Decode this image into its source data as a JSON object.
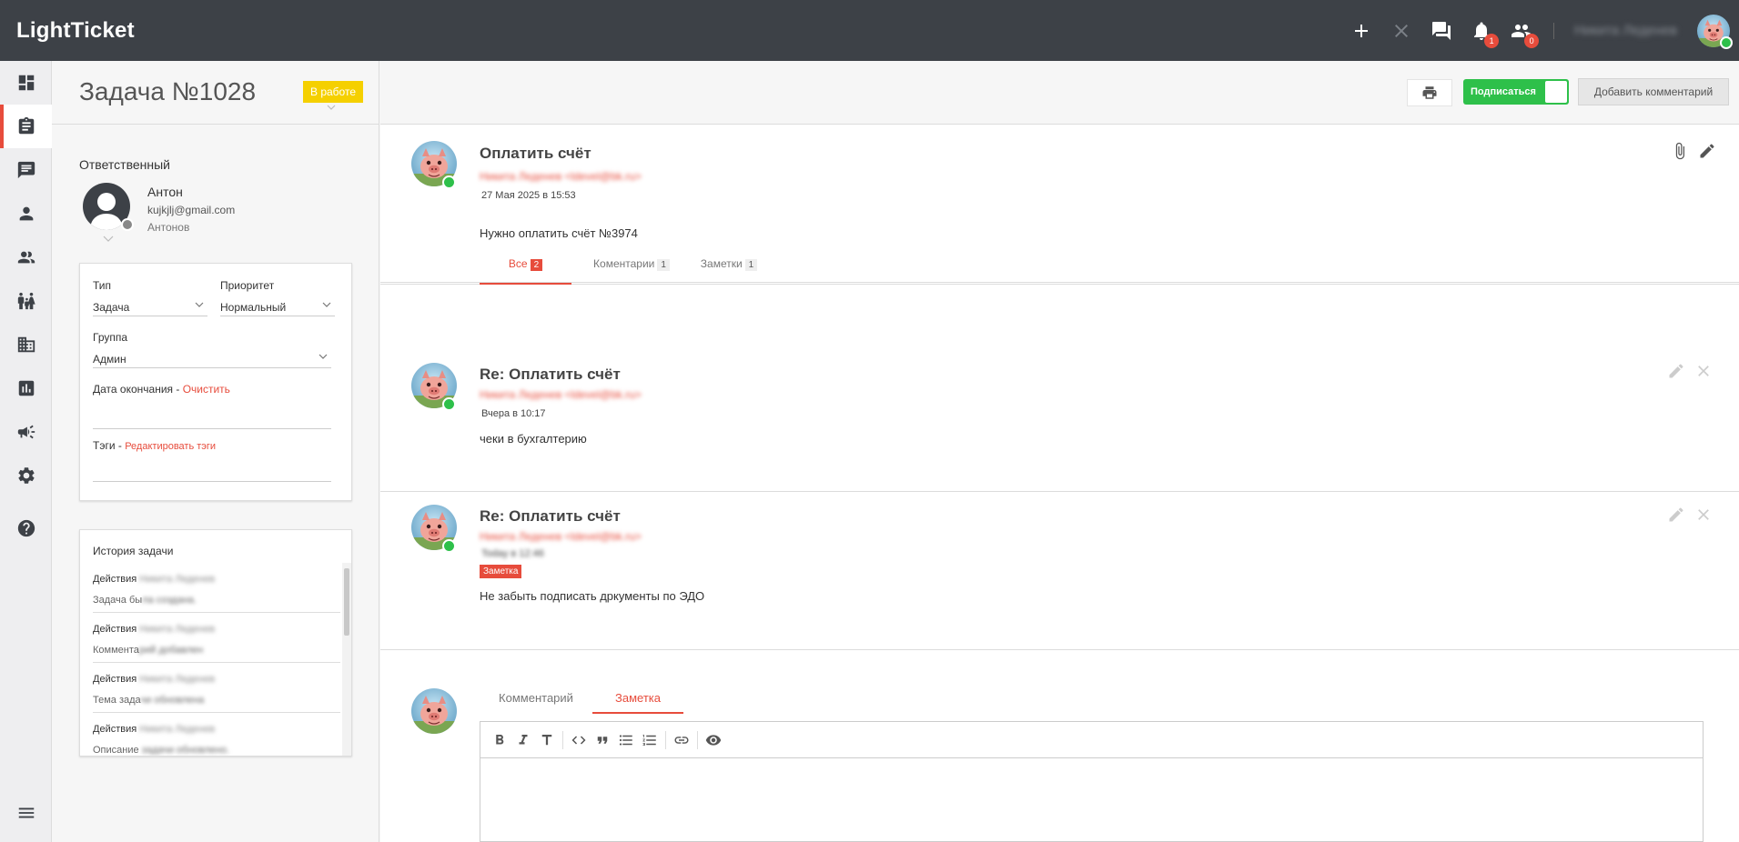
{
  "app": {
    "logo": "LightTicket"
  },
  "topbar": {
    "notifications_count": "1",
    "users_count": "0",
    "user_name": "Никита Леденев"
  },
  "task": {
    "title": "Задача №1028",
    "status": "В работе",
    "responsible_label": "Ответственный",
    "responsible_name": "Антон",
    "responsible_email": "kujkjlj@gmail.com",
    "responsible_sub": "Антонов"
  },
  "props": {
    "type_label": "Тип",
    "type_value": "Задача",
    "priority_label": "Приоритет",
    "priority_value": "Нормальный",
    "group_label": "Группа",
    "group_value": "Админ",
    "due_label": "Дата окончания - ",
    "due_clear": "Очистить",
    "tags_label": "Тэги - ",
    "tags_edit": "Редактировать тэги"
  },
  "history": {
    "title": "История задачи",
    "items": [
      {
        "action": "Действия",
        "user": "Никита Леденев",
        "desc_visible": "Задача бы",
        "desc_blur": "ла создана."
      },
      {
        "action": "Действия",
        "user": "Никита Леденев",
        "desc_visible": "Коммента",
        "desc_blur": "рий добавлен"
      },
      {
        "action": "Действия",
        "user": "Никита Леденев",
        "desc_visible": "Тема зада",
        "desc_blur": "чи обновлена"
      },
      {
        "action": "Действия",
        "user": "Никита Леденев",
        "desc_visible": "Описание ",
        "desc_blur": "задачи обновлено."
      }
    ]
  },
  "toolbar": {
    "subscribe_label": "Подписаться",
    "add_comment_label": "Добавить комментарий"
  },
  "main_post": {
    "title": "Оплатить счёт",
    "author": "Никита Леденев <ldevel@bk.ru>",
    "date": "27 Мая 2025 в 15:53",
    "body": "Нужно оплатить счёт №3974"
  },
  "tabs": [
    {
      "label": "Все",
      "count": "2"
    },
    {
      "label": "Коментарии",
      "count": "1"
    },
    {
      "label": "Заметки",
      "count": "1"
    }
  ],
  "comments": [
    {
      "title": "Re: Оплатить счёт",
      "author": "Никита Леденев <ldevel@bk.ru>",
      "date": "Вчера в 10:17",
      "body": "чеки в бухгалтерию"
    },
    {
      "title": "Re: Оплатить счёт",
      "author": "Никита Леденев <ldevel@bk.ru>",
      "date": "Today в 12:46",
      "badge": "Заметка",
      "body": "Не забыть подписать дркументы по ЭДО"
    }
  ],
  "composer": {
    "tab_comment": "Комментарий",
    "tab_note": "Заметка"
  },
  "colors": {
    "topbar": "#3d4147",
    "accent": "#e74c3c",
    "status": "#f5d000",
    "success": "#2ec04a"
  }
}
